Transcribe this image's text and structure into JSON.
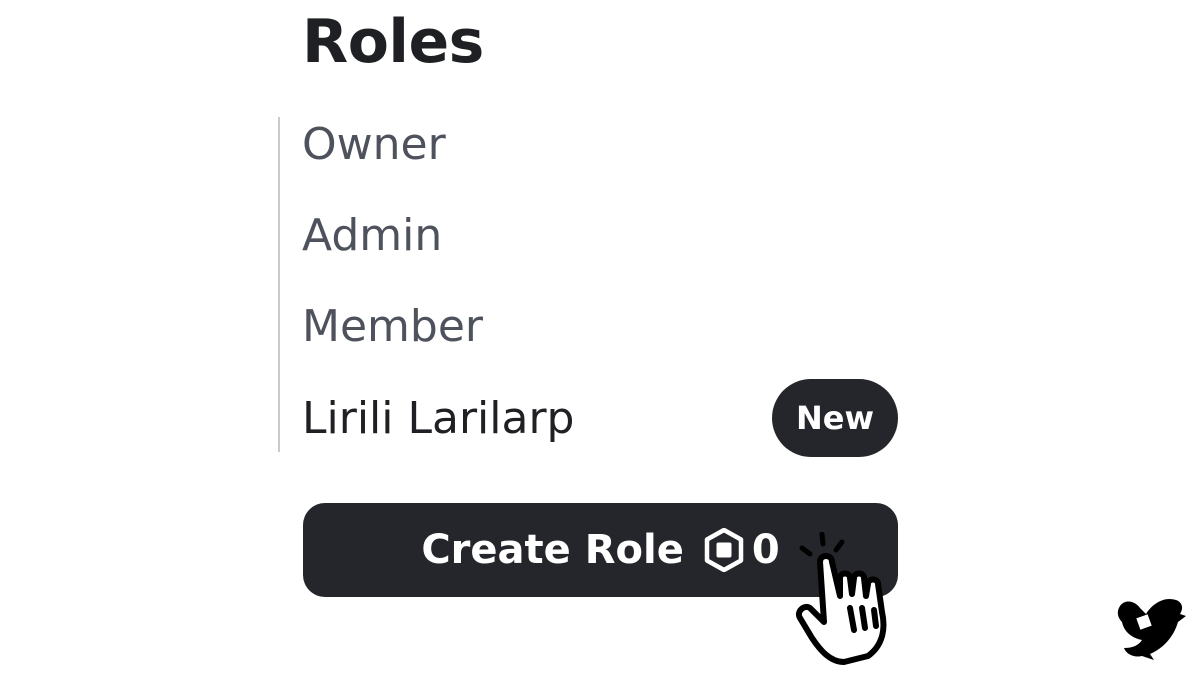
{
  "title": "Roles",
  "roles": [
    {
      "label": "Owner"
    },
    {
      "label": "Admin"
    },
    {
      "label": "Member"
    },
    {
      "label": "Lirili Larilarp",
      "badge": "New"
    }
  ],
  "create_button": {
    "label": "Create Role",
    "price": "0",
    "currency_icon": "robux-icon"
  },
  "cursor": {
    "icon": "pointer-hand-icon"
  },
  "watermark": {
    "icon": "bird-logo-icon"
  },
  "colors": {
    "title": "#1f2024",
    "role_text": "#4e525d",
    "button_bg": "#25262b",
    "divider": "#c9cacd"
  }
}
